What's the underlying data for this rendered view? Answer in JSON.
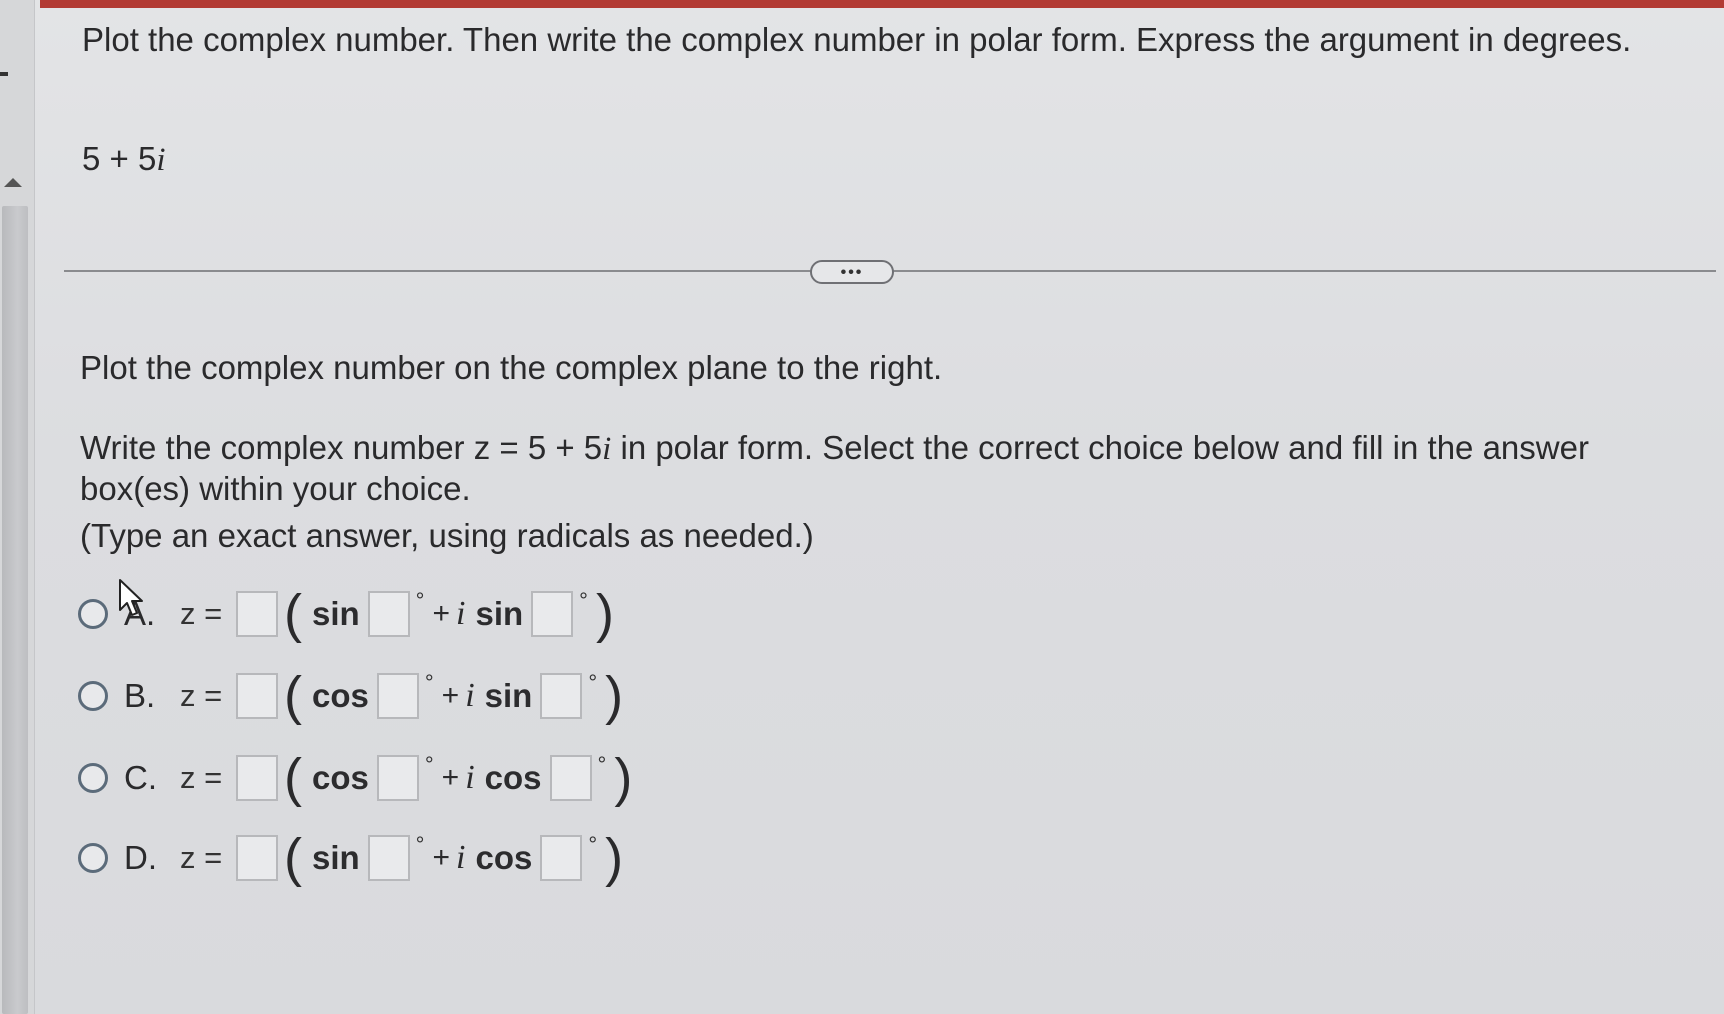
{
  "question": {
    "text": "Plot the complex number. Then write the complex number in polar form. Express the argument in degrees.",
    "expression_real": "5 + 5",
    "expression_imag": "i"
  },
  "more_button": {
    "label": "•••"
  },
  "instructions": {
    "plot": "Plot the complex number on the complex plane to the right.",
    "write_part1": "Write the complex number z = 5 + 5",
    "write_imag": "i",
    "write_part2": " in polar form. Select the correct choice below and fill in the answer box(es) within your choice.",
    "type_note": "(Type an exact answer, using radicals as needed.)"
  },
  "choices": [
    {
      "letter": "A.",
      "z_label": "z =",
      "fn1": "sin",
      "fn2": "sin",
      "plus": "+",
      "ivar": "i",
      "degree": "°"
    },
    {
      "letter": "B.",
      "z_label": "z =",
      "fn1": "cos",
      "fn2": "sin",
      "plus": "+",
      "ivar": "i",
      "degree": "°"
    },
    {
      "letter": "C.",
      "z_label": "z =",
      "fn1": "cos",
      "fn2": "cos",
      "plus": "+",
      "ivar": "i",
      "degree": "°"
    },
    {
      "letter": "D.",
      "z_label": "z =",
      "fn1": "sin",
      "fn2": "cos",
      "plus": "+",
      "ivar": "i",
      "degree": "°"
    }
  ],
  "paren_open": "(",
  "paren_close": ")",
  "colors": {
    "accent_bar": "#b23a33",
    "radio_border": "#5b6b7a",
    "background": "#dcdde0"
  }
}
